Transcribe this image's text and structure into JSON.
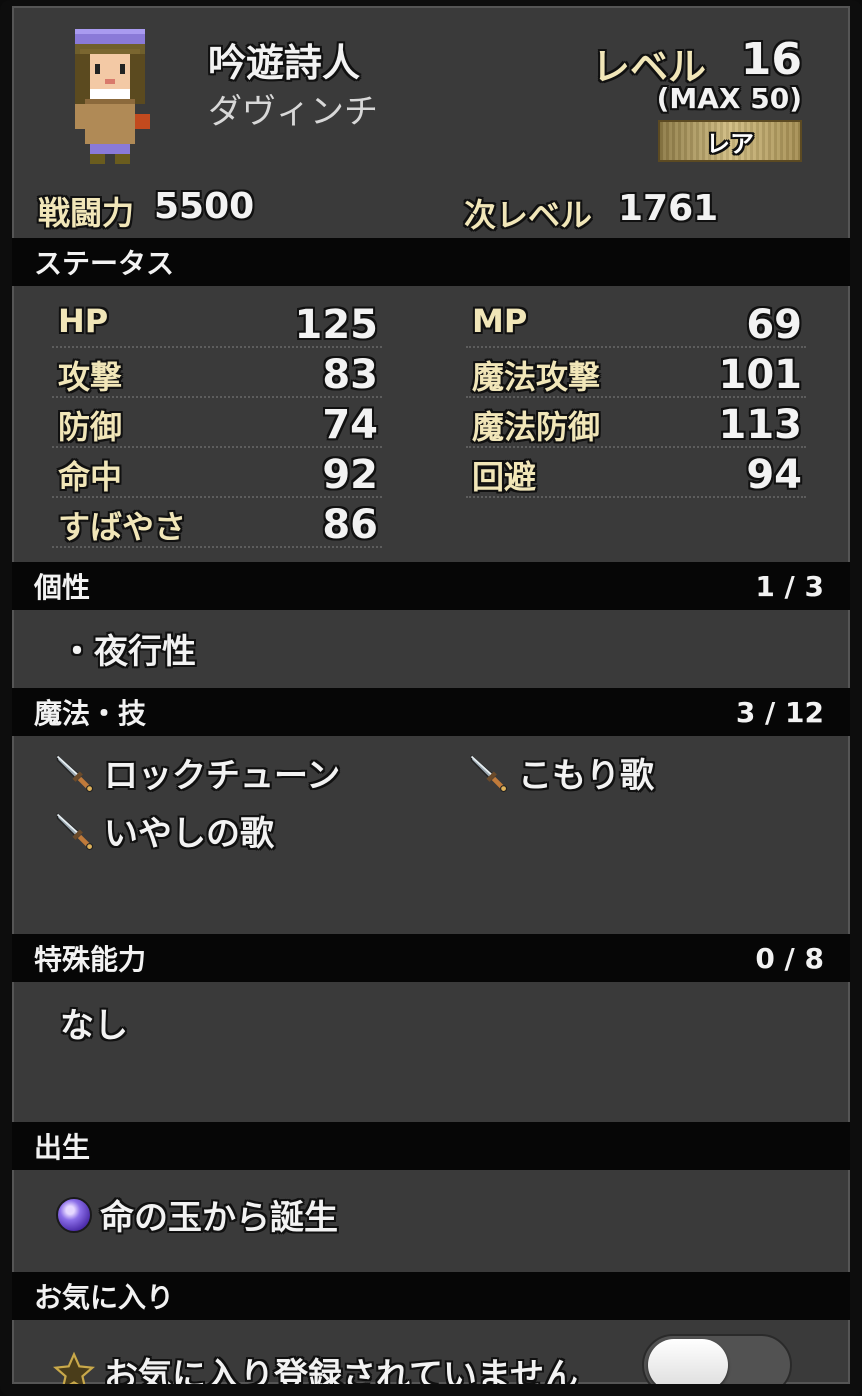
{
  "character": {
    "job": "吟遊詩人",
    "name": "ダヴィンチ",
    "level_label": "レベル",
    "level": "16",
    "level_max": "(MAX 50)",
    "rarity": "レア",
    "power_label": "戦闘力",
    "power": "5500",
    "next_level_label": "次レベル",
    "next_level": "1761"
  },
  "status": {
    "title": "ステータス",
    "left": [
      {
        "label": "HP",
        "value": "125"
      },
      {
        "label": "攻撃",
        "value": "83"
      },
      {
        "label": "防御",
        "value": "74"
      },
      {
        "label": "命中",
        "value": "92"
      },
      {
        "label": "すばやさ",
        "value": "86"
      }
    ],
    "right": [
      {
        "label": "MP",
        "value": "69"
      },
      {
        "label": "魔法攻撃",
        "value": "101"
      },
      {
        "label": "魔法防御",
        "value": "113"
      },
      {
        "label": "回避",
        "value": "94"
      }
    ]
  },
  "traits": {
    "title": "個性",
    "count": "1 / 3",
    "items": [
      "・夜行性"
    ]
  },
  "skills": {
    "title": "魔法・技",
    "count": "3 / 12",
    "items": [
      {
        "name": "ロックチューン",
        "icon": "sword-icon"
      },
      {
        "name": "こもり歌",
        "icon": "sword-icon"
      },
      {
        "name": "いやしの歌",
        "icon": "sword-icon"
      }
    ]
  },
  "special": {
    "title": "特殊能力",
    "count": "0 / 8",
    "text": "なし"
  },
  "origin": {
    "title": "出生",
    "text": "命の玉から誕生",
    "icon": "purple-orb-icon"
  },
  "favorite": {
    "title": "お気に入り",
    "text": "お気に入り登録されていません",
    "icon": "star-icon",
    "enabled": false
  },
  "colors": {
    "panel": "#3a3a3a",
    "bar": "#060606",
    "gold_text": "#f1e6b8",
    "rarity_gold": "#c9b273"
  }
}
